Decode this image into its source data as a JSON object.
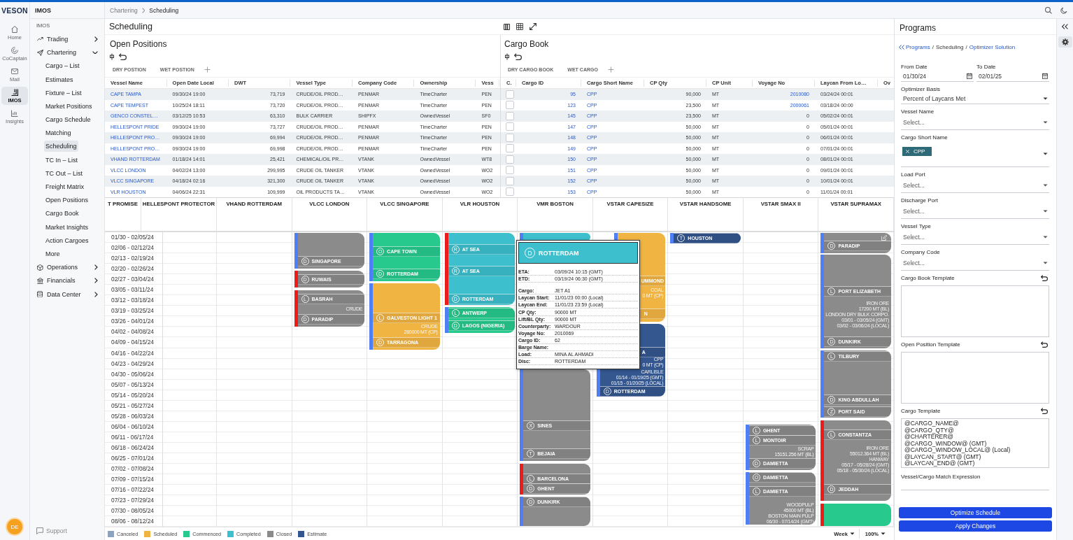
{
  "rail": {
    "logo": "VESON",
    "items": [
      {
        "label": "Home",
        "kind": "home",
        "selected": false
      },
      {
        "label": "CoCaptain",
        "kind": "swirl",
        "selected": false
      },
      {
        "label": "Mail",
        "kind": "mail",
        "selected": false
      },
      {
        "label": "IMOS",
        "kind": "bracket",
        "selected": true
      },
      {
        "label": "Insights",
        "kind": "chart",
        "selected": false
      }
    ],
    "avatar": "DE"
  },
  "nav": {
    "title": "IMOS",
    "section": "IMOS",
    "items": [
      {
        "label": "Trading",
        "kind": "trend",
        "expanded": false
      },
      {
        "label": "Chartering",
        "kind": "send",
        "expanded": true,
        "children": [
          {
            "label": "Cargo – List",
            "selected": false
          },
          {
            "label": "Estimates",
            "selected": false
          },
          {
            "label": "Fixture – List",
            "selected": false
          },
          {
            "label": "Market Positions",
            "selected": false
          },
          {
            "label": "Cargo Schedule",
            "selected": false
          },
          {
            "label": "Matching",
            "selected": false
          },
          {
            "label": "Scheduling",
            "selected": true
          },
          {
            "label": "TC In – List",
            "selected": false
          },
          {
            "label": "TC Out – List",
            "selected": false
          },
          {
            "label": "Freight Matrix",
            "selected": false
          },
          {
            "label": "Open Positions",
            "selected": false
          },
          {
            "label": "Cargo Book",
            "selected": false
          },
          {
            "label": "Market Insights",
            "selected": false
          },
          {
            "label": "Action Cargoes",
            "selected": false
          },
          {
            "label": "More",
            "selected": false
          }
        ]
      },
      {
        "label": "Operations",
        "kind": "cube",
        "expanded": false
      },
      {
        "label": "Financials",
        "kind": "bank",
        "expanded": false
      },
      {
        "label": "Data Center",
        "kind": "database",
        "expanded": false
      }
    ],
    "support": "Support"
  },
  "topbar": {
    "breadcrumb": [
      "Chartering",
      "Scheduling"
    ]
  },
  "page": {
    "title": "Scheduling"
  },
  "open_positions": {
    "title": "Open Positions",
    "tabs": [
      "DRY POSTION",
      "WET POSTION"
    ],
    "columns": [
      {
        "label": "Vessel Name",
        "kind": "link"
      },
      {
        "label": "Open Date Local",
        "kind": "text"
      },
      {
        "label": "DWT",
        "kind": "number"
      },
      {
        "label": "Vessel Type",
        "kind": "text"
      },
      {
        "label": "Company Code",
        "kind": "text"
      },
      {
        "label": "Ownership",
        "kind": "text"
      },
      {
        "label": "Vess",
        "kind": "text"
      }
    ],
    "rows": [
      {
        "cells": [
          "CAPE TAMPA",
          "09/30/24 19:00",
          "73,719",
          "CRUDE/OIL PROD…",
          "PENMAR",
          "TimeCharter",
          "PEN"
        ]
      },
      {
        "cells": [
          "CAPE TEMPEST",
          "10/25/24 18:11",
          "73,720",
          "CRUDE/OIL PROD…",
          "PENMAR",
          "TimeCharter",
          "PEN"
        ]
      },
      {
        "cells": [
          "GENCO CONSTEL…",
          "03/12/25 10:53",
          "63,310",
          "BULK CARRIER",
          "SHIPFX",
          "OwnedVessel",
          "SF0"
        ]
      },
      {
        "cells": [
          "HELLESPONT PRIDE",
          "09/30/24 19:00",
          "73,727",
          "CRUDE/OIL PROD…",
          "PENMAR",
          "TimeCharter",
          "PEN"
        ]
      },
      {
        "cells": [
          "HELLESPONT PRO…",
          "09/30/24 19:00",
          "69,994",
          "CRUDE/OIL PROD…",
          "PENMAR",
          "TimeCharter",
          "PEN"
        ]
      },
      {
        "cells": [
          "HELLESPONT PRO…",
          "09/30/24 19:00",
          "69,998",
          "CRUDE/OIL PROD…",
          "PENMAR",
          "TimeCharter",
          "PEN"
        ]
      },
      {
        "cells": [
          "VHAND ROTTERDAM",
          "01/18/24 14:01",
          "25,421",
          "CHEMICAL/OIL PR…",
          "VTANK",
          "OwnedVessel",
          "WT8"
        ]
      },
      {
        "cells": [
          "VLCC LONDON",
          "04/02/24 13:00",
          "299,995",
          "CRUDE OIL TANKER",
          "VTANK",
          "OwnedVessel",
          "WO2"
        ]
      },
      {
        "cells": [
          "VLCC SINGAPORE",
          "04/18/24 02:16",
          "321,300",
          "CRUDE OIL TANKER",
          "VTANK",
          "OwnedVessel",
          "WO2"
        ]
      },
      {
        "cells": [
          "VLR HOUSTON",
          "04/06/24 22:31",
          "109,999",
          "OIL PRODUCTS TA…",
          "VTANK",
          "OwnedVessel",
          "WO2"
        ]
      }
    ]
  },
  "cargo_book": {
    "title": "Cargo Book",
    "tabs": [
      "DRY CARGO BOOK",
      "WET CARGO"
    ],
    "check_column": "C.",
    "columns": [
      {
        "label": "Cargo ID",
        "kind": "link-number"
      },
      {
        "label": "Cargo Short Name",
        "kind": "link"
      },
      {
        "label": "CP Qty",
        "kind": "number"
      },
      {
        "label": "CP Unit",
        "kind": "text"
      },
      {
        "label": "Voyage No",
        "kind": "number"
      },
      {
        "label": "Laycan From Lo…",
        "kind": "text"
      },
      {
        "label": "Ov"
      }
    ],
    "rows": [
      {
        "checked": false,
        "cells": [
          "95",
          "CPP",
          "90,000",
          "MT",
          {
            "text": "2010080",
            "link": true
          },
          "03/24/24 00:01"
        ]
      },
      {
        "checked": false,
        "cells": [
          "123",
          "CPP",
          "23,500",
          "MT",
          {
            "text": "2000061",
            "link": true
          },
          "03/18/24 00:00"
        ]
      },
      {
        "checked": false,
        "cells": [
          "145",
          "CPP",
          "23,500",
          "MT",
          "0",
          "05/02/24 00:01"
        ]
      },
      {
        "checked": false,
        "cells": [
          "147",
          "CPP",
          "50,000",
          "MT",
          "0",
          "05/01/24 00:01"
        ]
      },
      {
        "checked": false,
        "cells": [
          "148",
          "CPP",
          "50,000",
          "MT",
          "0",
          "06/01/24 00:01"
        ]
      },
      {
        "checked": false,
        "cells": [
          "149",
          "CPP",
          "50,000",
          "MT",
          "0",
          "07/01/24 00:01"
        ]
      },
      {
        "checked": false,
        "cells": [
          "150",
          "CPP",
          "50,000",
          "MT",
          "0",
          "08/01/24 00:01"
        ]
      },
      {
        "checked": false,
        "cells": [
          "151",
          "CPP",
          "50,000",
          "MT",
          "0",
          "09/01/24 00:01"
        ]
      },
      {
        "checked": false,
        "cells": [
          "152",
          "CPP",
          "50,000",
          "MT",
          "0",
          "10/01/24 00:01"
        ]
      },
      {
        "checked": false,
        "cells": [
          "153",
          "CPP",
          "50,000",
          "MT",
          "0",
          "11/01/24 00:01"
        ]
      }
    ]
  },
  "gantt": {
    "vessels": [
      {
        "name": "T PROMISE"
      },
      {
        "name": "HELLESPONT PROTECTOR"
      },
      {
        "name": "VHAND ROTTERDAM"
      },
      {
        "name": "VLCC LONDON",
        "voyages": [
          {
            "kind": "closed",
            "color": "#4f7ff2",
            "editable": false,
            "lines": [
              {
                "kind": "stop",
                "letter": "D",
                "port": "SINGAPORE"
              }
            ]
          },
          {
            "kind": "closed",
            "color": "#ee1b1b",
            "editable": false,
            "lines": [
              {
                "kind": "stop",
                "letter": "D",
                "port": "RUWAIS"
              }
            ]
          },
          {
            "kind": "closed",
            "color": "#ee1b1b",
            "editable": false,
            "lines": [
              {
                "kind": "stop",
                "letter": "L",
                "port": "BASRAH"
              },
              {
                "kind": "note",
                "text": "CRUDE"
              },
              {
                "kind": "stop",
                "letter": "D",
                "port": "PARADIP"
              }
            ]
          }
        ]
      },
      {
        "name": "VLCC SINGAPORE",
        "voyages": [
          {
            "kind": "commenced",
            "color": "#4f7ff2",
            "editable": false,
            "lines": [
              {
                "kind": "stop",
                "letter": "O",
                "port": "CAPE TOWN"
              },
              {
                "kind": "stop",
                "letter": "D",
                "port": "ROTTERDAM"
              }
            ]
          },
          {
            "kind": "scheduled",
            "color": "#4f7ff2",
            "editable": false,
            "lines": [
              {
                "kind": "stop",
                "letter": "L",
                "port": "GALVESTON LIGHT 1"
              },
              {
                "kind": "note",
                "text": "CRUDE"
              },
              {
                "kind": "note",
                "text": "280000 MT (CP)"
              },
              {
                "kind": "stop",
                "letter": "D",
                "port": "TARRAGONA"
              }
            ]
          }
        ]
      },
      {
        "name": "VLR HOUSTON",
        "voyages": [
          {
            "kind": "completed",
            "color": "#ee1b1b",
            "editable": false,
            "lines": [
              {
                "kind": "stop",
                "letter": "R",
                "port": "AT SEA"
              },
              {
                "kind": "stop",
                "letter": "R",
                "port": "AT SEA"
              },
              {
                "kind": "stop",
                "letter": "D",
                "port": "ROTTERDAM"
              }
            ]
          },
          {
            "kind": "commenced",
            "color": "#4f7ff2",
            "editable": false,
            "lines": [
              {
                "kind": "stop",
                "letter": "L",
                "port": "ANTWERP"
              },
              {
                "kind": "stop",
                "letter": "D",
                "port": "LAGOS (NIGERIA)"
              }
            ]
          }
        ]
      },
      {
        "name": "VMR BOSTON",
        "voyages": [
          {
            "kind": "completed",
            "color": "#4f7ff2",
            "editable": false
          },
          {
            "kind": "closed",
            "color": "#4f7ff2",
            "editable": false,
            "lines": [
              {
                "kind": "stop",
                "letter": "X",
                "port": "SINES"
              },
              {
                "kind": "stop",
                "letter": "T",
                "port": "BEJAIA"
              }
            ]
          },
          {
            "kind": "closed",
            "color": "#ee1b1b",
            "editable": false,
            "lines": [
              {
                "kind": "stop",
                "letter": "L",
                "port": "BARCELONA"
              },
              {
                "kind": "stop",
                "letter": "D",
                "port": "GHENT"
              }
            ]
          },
          {
            "kind": "closed",
            "color": "#4f7ff2",
            "editable": false,
            "lines": [
              {
                "kind": "stop",
                "letter": "D",
                "port": "DUNKIRK"
              }
            ]
          }
        ]
      },
      {
        "name": "VSTAR CAPESIZE",
        "voyages": [
          {
            "kind": "scheduled",
            "color": "#4f7ff2",
            "editable": false,
            "lines": [
              {
                "kind": "partial",
                "text": "UMMOND"
              },
              {
                "kind": "note",
                "text": "COAL"
              },
              {
                "kind": "note",
                "text": "0 MT (CP)"
              },
              {
                "kind": "partial",
                "text": "N"
              }
            ]
          },
          {
            "kind": "estimate",
            "color": "#4f7ff2",
            "editable": false,
            "lines": [
              {
                "kind": "partial",
                "text": "A"
              },
              {
                "kind": "note",
                "text": "CPP"
              },
              {
                "kind": "note",
                "text": "0 MT (CP)"
              },
              {
                "kind": "note",
                "text": "CARLISLE"
              },
              {
                "kind": "note",
                "text": "01/14 - 01/19/25 (GMT)"
              },
              {
                "kind": "note",
                "text": "01/15 - 01/20/25 (LOCAL)"
              },
              {
                "kind": "stop",
                "letter": "D",
                "port": "ROTTERDAM"
              }
            ]
          }
        ]
      },
      {
        "name": "VSTAR HANDSOME",
        "voyages": [
          {
            "kind": "estimate",
            "color": "#4f7ff2",
            "editable": false,
            "lines": [
              {
                "kind": "stop",
                "letter": "T",
                "port": "HOUSTON"
              }
            ]
          }
        ]
      },
      {
        "name": "VSTAR SMAX II",
        "voyages": [
          {
            "kind": "closed",
            "color": "#4f7ff2",
            "editable": false,
            "lines": [
              {
                "kind": "stop",
                "letter": "L",
                "port": "GHENT"
              },
              {
                "kind": "stop",
                "letter": "L",
                "port": "MONTOIR"
              },
              {
                "kind": "note",
                "text": "SCRAP"
              },
              {
                "kind": "note",
                "text": "15151.256 MT (BL)"
              },
              {
                "kind": "stop",
                "letter": "D",
                "port": "DAMIETTA"
              }
            ]
          },
          {
            "kind": "closed",
            "color": "#4f7ff2",
            "editable": false,
            "lines": [
              {
                "kind": "stop",
                "letter": "O",
                "port": "DAMIETTA"
              },
              {
                "kind": "stop",
                "letter": "L",
                "port": "DAMIETTA"
              },
              {
                "kind": "note",
                "text": "WOODPULP"
              },
              {
                "kind": "note",
                "text": "45000 MT (BL)"
              },
              {
                "kind": "note",
                "text": "BOSTON MAIN PULP"
              },
              {
                "kind": "note",
                "text": "06/30 - 07/14/24 (GMT)"
              }
            ]
          }
        ]
      },
      {
        "name": "VSTAR SUPRAMAX",
        "voyages": [
          {
            "kind": "closed",
            "color": "#4f7ff2",
            "editable": true,
            "lines": [
              {
                "kind": "stop",
                "letter": "D",
                "port": "PARADIP"
              }
            ]
          },
          {
            "kind": "closed",
            "color": "#4f7ff2",
            "editable": false,
            "lines": [
              {
                "kind": "stop",
                "letter": "L",
                "port": "PORT ELIZABETH"
              },
              {
                "kind": "note",
                "text": "IRON ORE"
              },
              {
                "kind": "note",
                "text": "17200 MT (BL)"
              },
              {
                "kind": "note",
                "text": "LONDON DRY BULK CORPO."
              },
              {
                "kind": "note",
                "text": "03/01 - 03/05/24 (GMT)"
              },
              {
                "kind": "note",
                "text": "03/02 - 03/06/24 (LOCAL)"
              },
              {
                "kind": "stop",
                "letter": "D",
                "port": "DUNKIRK"
              }
            ]
          },
          {
            "kind": "closed",
            "color": "#4f7ff2",
            "editable": false,
            "lines": [
              {
                "kind": "stop",
                "letter": "L",
                "port": "TILBURY"
              },
              {
                "kind": "stop",
                "letter": "D",
                "port": "KING ABDULLAH"
              },
              {
                "kind": "stop",
                "letter": "Z",
                "port": "PORT SAID"
              }
            ]
          },
          {
            "kind": "closed",
            "color": "#ee1b1b",
            "editable": false,
            "lines": [
              {
                "kind": "stop",
                "letter": "L",
                "port": "CONSTANTZA"
              },
              {
                "kind": "note",
                "text": "IRON ORE"
              },
              {
                "kind": "note",
                "text": "55012.364 MT (BL)"
              },
              {
                "kind": "note",
                "text": "HANWAY"
              },
              {
                "kind": "note",
                "text": "05/17 - 05/28/24 (GMT)"
              },
              {
                "kind": "note",
                "text": "05/18 - 05/30/24 (LOCAL)"
              },
              {
                "kind": "stop",
                "letter": "D",
                "port": "JEDDAH"
              }
            ]
          },
          {
            "kind": "commenced",
            "color": "#ee1b1b",
            "editable": false
          }
        ]
      }
    ],
    "weeks": [
      "01/30 - 02/05/24",
      "02/06 - 02/12/24",
      "02/13 - 02/19/24",
      "02/20 - 02/26/24",
      "02/27 - 03/04/24",
      "03/05 - 03/11/24",
      "03/12 - 03/18/24",
      "03/19 - 03/25/24",
      "03/26 - 04/01/24",
      "04/02 - 04/08/24",
      "04/09 - 04/15/24",
      "04/16 - 04/22/24",
      "04/23 - 04/29/24",
      "04/30 - 05/06/24",
      "05/07 - 05/13/24",
      "05/14 - 05/20/24",
      "05/21 - 05/27/24",
      "05/28 - 06/03/24",
      "06/04 - 06/10/24",
      "06/11 - 06/17/24",
      "06/18 - 06/24/24",
      "06/25 - 07/01/24",
      "07/02 - 07/08/24",
      "07/09 - 07/15/24",
      "07/16 - 07/22/24",
      "07/23 - 07/29/24",
      "07/30 - 08/05/24",
      "08/06 - 08/12/24"
    ],
    "tooltip": {
      "kind": "completed",
      "letter": "D",
      "port": "ROTTERDAM",
      "times": [
        {
          "label": "ETA:",
          "value": "03/09/24 10:15 (GMT)"
        },
        {
          "label": "ETD:",
          "value": "03/19/24 06:30 (GMT)"
        }
      ],
      "details": [
        {
          "label": "Cargo:",
          "value": "JET A1"
        },
        {
          "label": "Laycan Start:",
          "value": "11/01/23 00:00 (Local)"
        },
        {
          "label": "Laycan End:",
          "value": "11/01/23 23:59 (Local)"
        },
        {
          "label": "CP Qty:",
          "value": "90000 MT"
        },
        {
          "label": "Lift/BL Qty:",
          "value": "90000 MT"
        },
        {
          "label": "Counterparty:",
          "value": "WARDOUR"
        },
        {
          "label": "Voyage No:",
          "value": "2010069"
        },
        {
          "label": "Cargo ID:",
          "value": "62"
        },
        {
          "label": "Barge Name:"
        },
        {
          "label": "Load:",
          "value": "MINA AL AHMADI"
        },
        {
          "label": "Disc:",
          "value": "ROTTERDAM"
        }
      ]
    },
    "legend": [
      {
        "label": "Canceled",
        "kind": "canceled",
        "color": "#8ea1bd"
      },
      {
        "label": "Scheduled",
        "kind": "scheduled",
        "color": "#f0b443"
      },
      {
        "label": "Commenced",
        "kind": "commenced",
        "color": "#27c98d"
      },
      {
        "label": "Completed",
        "kind": "completed",
        "color": "#3dbfce"
      },
      {
        "label": "Closed",
        "kind": "closed",
        "color": "#8b8b8b"
      },
      {
        "label": "Estimate",
        "kind": "estimate",
        "color": "#34578f"
      }
    ],
    "view": "Week",
    "zoom": "100%"
  },
  "programs": {
    "title": "Programs",
    "breadcrumb": {
      "separator": "/",
      "items": [
        {
          "text": "Programs",
          "link": true
        },
        {
          "text": "Scheduling",
          "link": false
        },
        {
          "text": "Optimizer Solution",
          "link": true
        }
      ]
    },
    "dates": [
      {
        "label": "From Date",
        "value": "01/30/24"
      },
      {
        "label": "To Date",
        "value": "02/01/25"
      }
    ],
    "selects": [
      {
        "label": "Optimizer Basis",
        "value": "Percent of Laycans Met"
      },
      {
        "label": "Vessel Name",
        "placeholder": "Select..."
      },
      {
        "label": "Cargo Short Name",
        "tags": [
          "CPP"
        ]
      },
      {
        "label": "Load Port",
        "placeholder": "Select..."
      },
      {
        "label": "Discharge Port",
        "placeholder": "Select..."
      },
      {
        "label": "Vessel Type",
        "placeholder": "Select..."
      },
      {
        "label": "Company Code",
        "placeholder": "Select..."
      }
    ],
    "templates": [
      {
        "label": "Cargo Book Template"
      },
      {
        "label": "Open Position Template"
      },
      {
        "label": "Cargo Template",
        "value": "@CARGO_NAME@\n@CARGO_QTY@\n@CHARTERER@\n@CARGO_WINDOW@ (GMT)\n@CARGO_WINDOW_LOCAL@ (Local)\n@LAYCAN_START@ (GMT)\n@LAYCAN_END@ (GMT)"
      }
    ],
    "expression": {
      "label": "Vessel/Cargo Match Expression"
    },
    "buttons": [
      "Optimize Schedule",
      "Apply Changes"
    ]
  },
  "right_rail": [
    {
      "kind": "collapse",
      "selected": false
    },
    {
      "kind": "settings",
      "selected": true
    }
  ]
}
